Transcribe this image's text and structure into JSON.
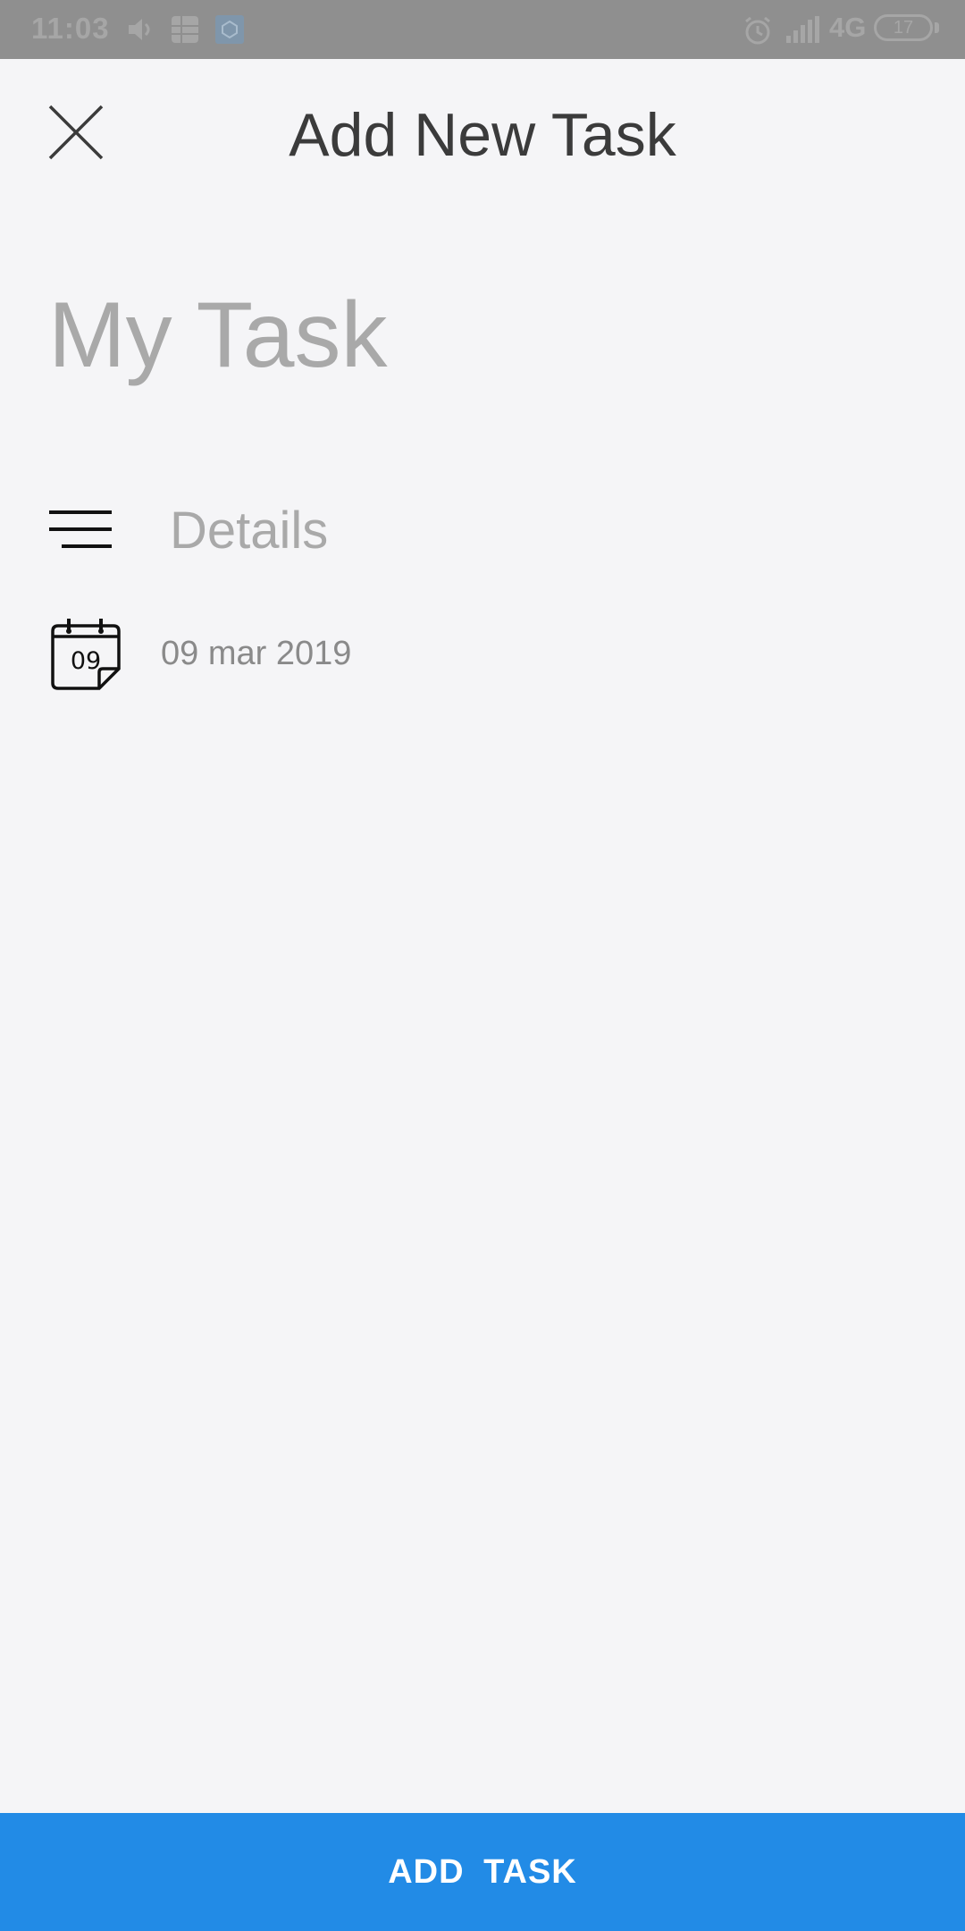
{
  "status_bar": {
    "time": "11:03",
    "network": "4G",
    "battery": "17",
    "icons": [
      "volume-icon",
      "grid-icon",
      "app-icon",
      "alarm-icon",
      "signal-icon"
    ]
  },
  "header": {
    "title": "Add New Task",
    "close_icon": "close-icon"
  },
  "form": {
    "task_name_placeholder": "My Task",
    "task_name_value": "",
    "details_placeholder": "Details",
    "details_value": "",
    "details_icon": "notes-lines-icon",
    "date_icon": "calendar-icon",
    "date_icon_day": "09",
    "date": "09 mar 2019"
  },
  "footer": {
    "add_task_label": "ADD TASK"
  },
  "colors": {
    "background": "#f5f5f7",
    "status_bar": "#8f8f8f",
    "accent": "#228be6",
    "title_text": "#3b3b3b",
    "placeholder_text": "#a9a9a9",
    "date_text": "#8a8a8a"
  }
}
